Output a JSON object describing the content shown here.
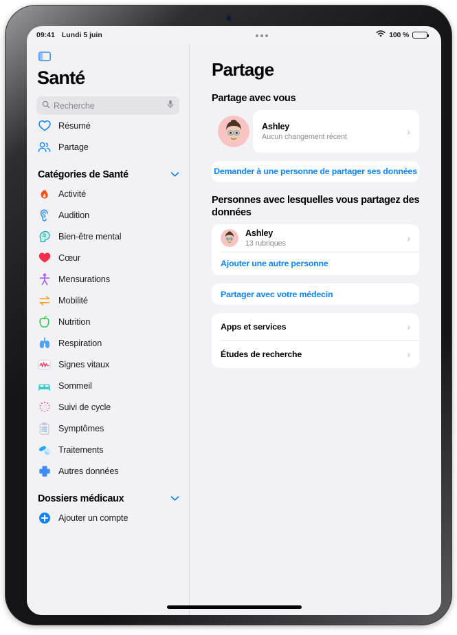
{
  "status_bar": {
    "time": "09:41",
    "date": "Lundi 5 juin",
    "battery_percent": "100 %",
    "wifi_icon": "wifi-icon",
    "battery_icon": "battery-icon"
  },
  "sidebar": {
    "toggle_icon": "sidebar-toggle-icon",
    "app_title": "Santé",
    "search": {
      "placeholder": "Recherche",
      "value": "",
      "search_icon": "search-icon",
      "mic_icon": "microphone-icon"
    },
    "top_items": [
      {
        "label": "Résumé",
        "icon": "heart-outline-icon",
        "color": "#0a84ff"
      },
      {
        "label": "Partage",
        "icon": "people-icon",
        "color": "#0a84ff"
      }
    ],
    "categories_section": {
      "title": "Catégories de Santé",
      "chevron_icon": "chevron-down-icon",
      "expanded": true,
      "items": [
        {
          "label": "Activité",
          "icon": "flame-icon",
          "color": "#ff3b30"
        },
        {
          "label": "Audition",
          "icon": "ear-icon",
          "color": "#0a84ff"
        },
        {
          "label": "Bien-être mental",
          "icon": "head-brain-icon",
          "color": "#30b8b2"
        },
        {
          "label": "Cœur",
          "icon": "heart-filled-icon",
          "color": "#fa2d48"
        },
        {
          "label": "Mensurations",
          "icon": "body-figure-icon",
          "color": "#a55cf0"
        },
        {
          "label": "Mobilité",
          "icon": "mobility-arrows-icon",
          "color": "#ffa114"
        },
        {
          "label": "Nutrition",
          "icon": "apple-icon",
          "color": "#28c94c"
        },
        {
          "label": "Respiration",
          "icon": "lungs-icon",
          "color": "#4aa6f5"
        },
        {
          "label": "Signes vitaux",
          "icon": "vitals-waveform-icon",
          "color": "#ff375f"
        },
        {
          "label": "Sommeil",
          "icon": "bed-icon",
          "color": "#30c8c0"
        },
        {
          "label": "Suivi de cycle",
          "icon": "cycle-tracking-icon",
          "color": "#ff5d8f"
        },
        {
          "label": "Symptômes",
          "icon": "clipboard-icon",
          "color": "#5a8df0"
        },
        {
          "label": "Traitements",
          "icon": "pills-icon",
          "color": "#29a9ff"
        },
        {
          "label": "Autres données",
          "icon": "plus-cross-icon",
          "color": "#3f8ef7"
        }
      ]
    },
    "records_section": {
      "title": "Dossiers médicaux",
      "chevron_icon": "chevron-down-icon",
      "expanded": true,
      "items": [
        {
          "label": "Ajouter un compte",
          "icon": "plus-circle-icon",
          "color": "#0a84ff"
        }
      ]
    }
  },
  "main": {
    "page_title": "Partage",
    "shared_with_you": {
      "heading": "Partage avec vous",
      "person": {
        "name": "Ashley",
        "subtitle": "Aucun changement récent",
        "avatar": "ashley-avatar",
        "chevron_icon": "chevron-right-icon"
      },
      "request_button": "Demander à une personne de partager ses données"
    },
    "sharing_with": {
      "heading": "Personnes avec lesquelles vous partagez des données",
      "person": {
        "name": "Ashley",
        "subtitle": "13 rubriques",
        "avatar": "ashley-avatar",
        "chevron_icon": "chevron-right-icon"
      },
      "add_person_link": "Ajouter une autre personne"
    },
    "doctor_button": "Partager avec votre médecin",
    "extra_rows": [
      {
        "label": "Apps et services",
        "chevron_icon": "chevron-right-icon"
      },
      {
        "label": "Études de recherche",
        "chevron_icon": "chevron-right-icon"
      }
    ]
  },
  "colors": {
    "accent": "#0a84ff",
    "background": "#f1f1f6",
    "card": "#ffffff"
  }
}
